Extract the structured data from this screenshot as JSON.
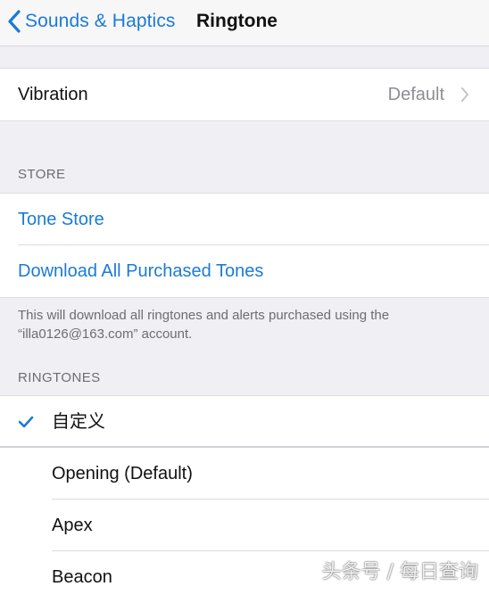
{
  "nav": {
    "back_label": "Sounds & Haptics",
    "title": "Ringtone"
  },
  "vibration": {
    "label": "Vibration",
    "value": "Default"
  },
  "store": {
    "header": "STORE",
    "tone_store": "Tone Store",
    "download_all": "Download All Purchased Tones",
    "footer": "This will download all ringtones and alerts purchased using the “illa0126@163.com” account."
  },
  "ringtones": {
    "header": "RINGTONES",
    "items": [
      {
        "label": "自定义",
        "selected": true
      },
      {
        "label": "Opening (Default)",
        "selected": false
      },
      {
        "label": "Apex",
        "selected": false
      },
      {
        "label": "Beacon",
        "selected": false
      }
    ]
  },
  "watermark": "头条号 / 每日查询",
  "colors": {
    "accent": "#1a7bd6",
    "background": "#efeff4",
    "secondary_text": "#6d6d72"
  }
}
